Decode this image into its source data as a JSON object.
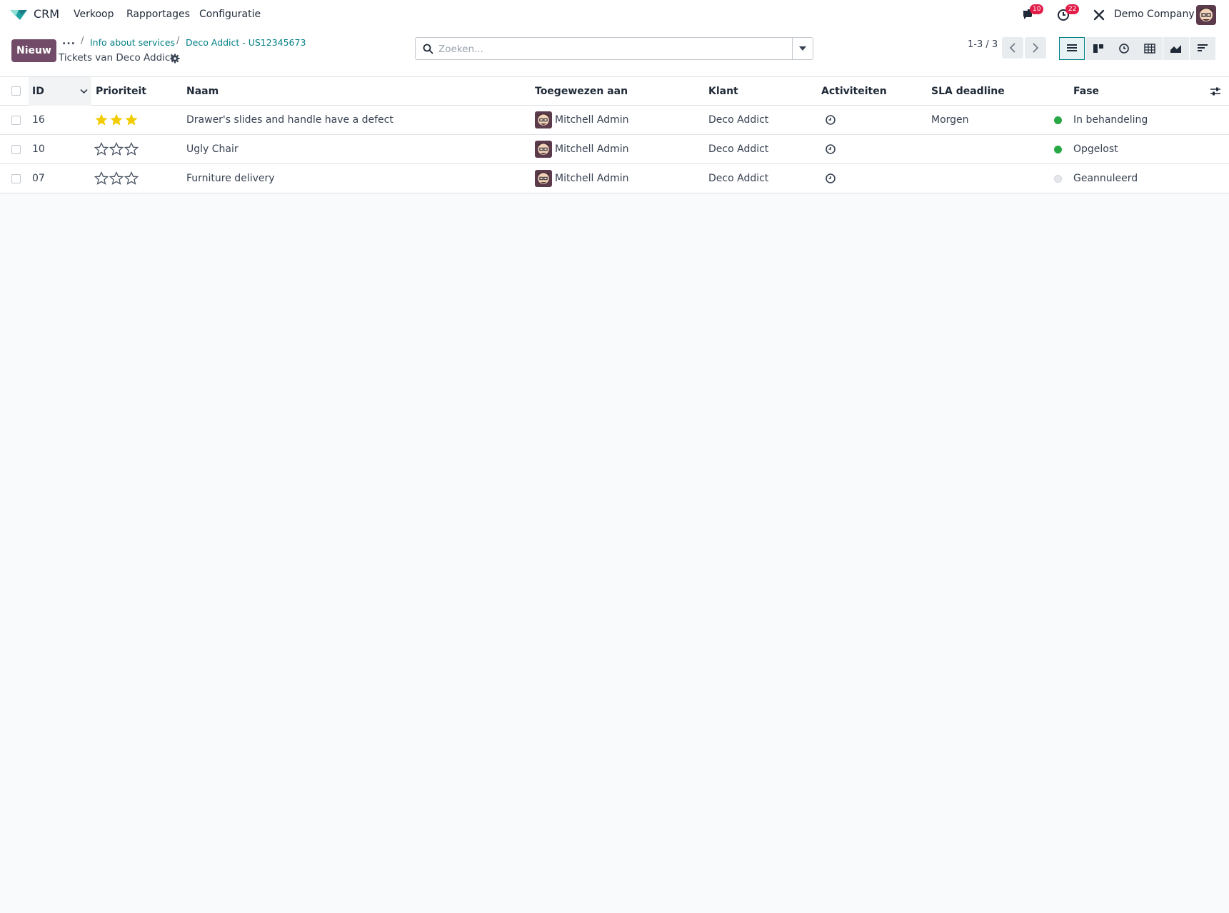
{
  "navbar": {
    "app_name": "CRM",
    "menus": [
      "Verkoop",
      "Rapportages",
      "Configuratie"
    ],
    "messages_badge": "10",
    "activities_badge": "22",
    "company": "Demo Company"
  },
  "control": {
    "new_button": "Nieuw",
    "breadcrumb_dots": "...",
    "breadcrumbs": [
      "Info about services",
      "Deco Addict - US12345673"
    ],
    "current_title": "Tickets van Deco Addict",
    "search_placeholder": "Zoeken...",
    "pager": "1-3 / 3"
  },
  "table": {
    "columns": {
      "id": "ID",
      "priority": "Prioriteit",
      "name": "Naam",
      "assigned": "Toegewezen aan",
      "customer": "Klant",
      "activities": "Activiteiten",
      "sla": "SLA deadline",
      "stage": "Fase"
    },
    "rows": [
      {
        "id": "16",
        "priority": 3,
        "name": "Drawer's slides and handle have a defect",
        "assigned": "Mitchell Admin",
        "customer": "Deco Addict",
        "sla": "Morgen",
        "stage": "In behandeling",
        "stage_color": "#28a745"
      },
      {
        "id": "10",
        "priority": 0,
        "name": "Ugly Chair",
        "assigned": "Mitchell Admin",
        "customer": "Deco Addict",
        "sla": "",
        "stage": "Opgelost",
        "stage_color": "#28a745"
      },
      {
        "id": "07",
        "priority": 0,
        "name": "Furniture delivery",
        "assigned": "Mitchell Admin",
        "customer": "Deco Addict",
        "sla": "",
        "stage": "Geannuleerd",
        "stage_color": "#e5e7eb"
      }
    ]
  },
  "colors": {
    "primary": "#714b67",
    "link": "#017e84",
    "star_filled": "#f3cc00",
    "badge": "#e11d48"
  }
}
